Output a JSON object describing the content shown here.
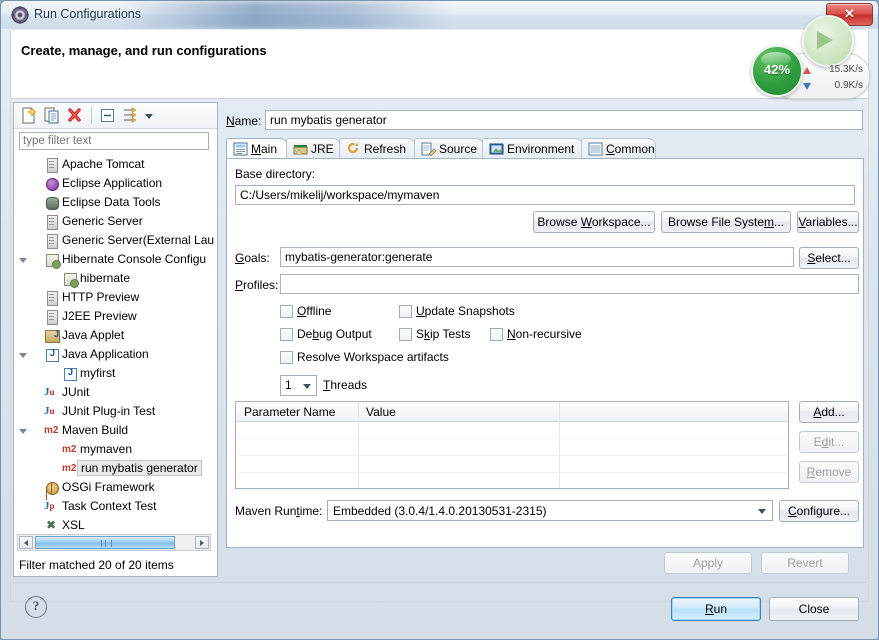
{
  "window": {
    "title": "Run Configurations",
    "app_icon": "eclipse-run-icon",
    "close_label": "✕"
  },
  "banner": {
    "title": "Create, manage, and run configurations"
  },
  "netmeter": {
    "percent_label": "42%",
    "upload_speed": "15.3K/s",
    "download_speed": "0.9K/s",
    "upload_icon": "arrow-up-icon",
    "download_icon": "arrow-down-icon",
    "accent_green": "#2f9e3f",
    "upload_color": "#d8534f",
    "download_color": "#3a78c4"
  },
  "tree_panel": {
    "toolbar": [
      {
        "name": "new-configuration-icon",
        "label": "New"
      },
      {
        "name": "duplicate-configuration-icon",
        "label": "Duplicate"
      },
      {
        "name": "delete-configuration-icon",
        "label": "Delete"
      },
      {
        "name": "collapse-all-icon",
        "label": "Collapse All"
      },
      {
        "name": "filter-icon",
        "label": "Filter"
      },
      {
        "name": "chevron-down-icon",
        "label": "Filter menu"
      }
    ],
    "filter_placeholder": "type filter text",
    "filter_value": "",
    "status": "Filter matched 20 of 20 items",
    "items": [
      {
        "label": "Apache Tomcat",
        "icon": "server-icon",
        "indent": 0,
        "twisty": "",
        "selected": false
      },
      {
        "label": "Eclipse Application",
        "icon": "eclipse-icon",
        "indent": 0,
        "twisty": "",
        "selected": false
      },
      {
        "label": "Eclipse Data Tools",
        "icon": "database-icon",
        "indent": 0,
        "twisty": "",
        "selected": false
      },
      {
        "label": "Generic Server",
        "icon": "server-icon",
        "indent": 0,
        "twisty": "",
        "selected": false
      },
      {
        "label": "Generic Server(External Laun",
        "icon": "server-icon",
        "indent": 0,
        "twisty": "",
        "selected": false
      },
      {
        "label": "Hibernate Console Configu",
        "icon": "hibernate-icon",
        "indent": 0,
        "twisty": "expanded",
        "selected": false
      },
      {
        "label": "hibernate",
        "icon": "hibernate-icon",
        "indent": 1,
        "twisty": "",
        "selected": false
      },
      {
        "label": "HTTP Preview",
        "icon": "server-icon",
        "indent": 0,
        "twisty": "",
        "selected": false
      },
      {
        "label": "J2EE Preview",
        "icon": "server-icon",
        "indent": 0,
        "twisty": "",
        "selected": false
      },
      {
        "label": "Java Applet",
        "icon": "java-applet-icon",
        "indent": 0,
        "twisty": "",
        "selected": false
      },
      {
        "label": "Java Application",
        "icon": "java-icon",
        "indent": 0,
        "twisty": "expanded",
        "selected": false
      },
      {
        "label": "myfirst",
        "icon": "java-icon",
        "indent": 1,
        "twisty": "",
        "selected": false
      },
      {
        "label": "JUnit",
        "icon": "junit-icon",
        "indent": 0,
        "twisty": "",
        "selected": false
      },
      {
        "label": "JUnit Plug-in Test",
        "icon": "junit-plugin-icon",
        "indent": 0,
        "twisty": "",
        "selected": false
      },
      {
        "label": "Maven Build",
        "icon": "maven-icon",
        "indent": 0,
        "twisty": "expanded",
        "selected": false
      },
      {
        "label": "mymaven",
        "icon": "maven-icon",
        "indent": 1,
        "twisty": "",
        "selected": false
      },
      {
        "label": "run mybatis generator",
        "icon": "maven-icon",
        "indent": 1,
        "twisty": "",
        "selected": true
      },
      {
        "label": "OSGi Framework",
        "icon": "osgi-icon",
        "indent": 0,
        "twisty": "",
        "selected": false
      },
      {
        "label": "Task Context Test",
        "icon": "task-context-icon",
        "indent": 0,
        "twisty": "",
        "selected": false
      },
      {
        "label": "XSL",
        "icon": "xsl-icon",
        "indent": 0,
        "twisty": "",
        "selected": false
      }
    ]
  },
  "config": {
    "name_label": "Name:",
    "name_value": "run mybatis generator",
    "tabs": [
      {
        "label": "Main",
        "icon": "main-tab-icon",
        "active": true
      },
      {
        "label": "JRE",
        "icon": "jre-tab-icon",
        "active": false
      },
      {
        "label": "Refresh",
        "icon": "refresh-tab-icon",
        "active": false
      },
      {
        "label": "Source",
        "icon": "source-tab-icon",
        "active": false
      },
      {
        "label": "Environment",
        "icon": "environment-tab-icon",
        "active": false
      },
      {
        "label": "Common",
        "icon": "common-tab-icon",
        "active": false
      }
    ],
    "base_directory_label": "Base directory:",
    "base_directory_value": "C:/Users/mikelij/workspace/mymaven",
    "browse_workspace": "Browse Workspace...",
    "browse_file_system": "Browse File System...",
    "variables": "Variables...",
    "goals_label": "Goals:",
    "goals_value": "mybatis-generator:generate",
    "select_button": "Select...",
    "profiles_label": "Profiles:",
    "profiles_value": "",
    "checkboxes": [
      {
        "label": "Offline",
        "checked": false
      },
      {
        "label": "Update Snapshots",
        "checked": false
      },
      {
        "label": "Debug Output",
        "checked": false
      },
      {
        "label": "Skip Tests",
        "checked": false
      },
      {
        "label": "Non-recursive",
        "checked": false
      },
      {
        "label": "Resolve Workspace artifacts",
        "checked": false
      }
    ],
    "threads_value": "1",
    "threads_label": "Threads",
    "table": {
      "columns": [
        "Parameter Name",
        "Value"
      ],
      "rows": []
    },
    "add_button": "Add...",
    "edit_button": "Edit...",
    "remove_button": "Remove",
    "maven_runtime_label": "Maven Runtime:",
    "maven_runtime_value": "Embedded (3.0.4/1.4.0.20130531-2315)",
    "configure_button": "Configure..."
  },
  "footer": {
    "apply": "Apply",
    "revert": "Revert",
    "run": "Run",
    "close": "Close",
    "help_icon": "help-icon",
    "help_glyph": "?"
  }
}
